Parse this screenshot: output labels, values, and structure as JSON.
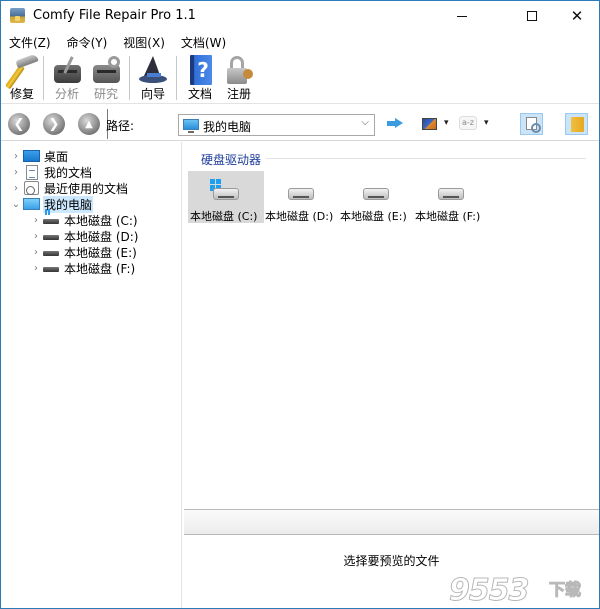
{
  "window": {
    "title": "Comfy File Repair Pro 1.1",
    "minimize": "minimize",
    "maximize": "maximize",
    "close": "✕"
  },
  "menu": [
    "文件(Z)",
    "命令(Y)",
    "视图(X)",
    "文档(W)"
  ],
  "toolbar": {
    "repair": "修复",
    "analyze": "分析",
    "research": "研究",
    "wizard": "向导",
    "docs": "文档",
    "register": "注册",
    "docs_glyph": "?"
  },
  "navbar": {
    "back_glyph": "❮",
    "forward_glyph": "❯",
    "up_glyph": "▲",
    "path_label": "路径:",
    "path_value": "我的电脑",
    "combo_arrow": "⌵",
    "dropdown_arrow": "▾",
    "sort_text": "a-z"
  },
  "tree": {
    "items": [
      {
        "label": "桌面",
        "expander": "›",
        "icon": "desktop-icon"
      },
      {
        "label": "我的文档",
        "expander": "›",
        "icon": "document-icon"
      },
      {
        "label": "最近使用的文档",
        "expander": "›",
        "icon": "recent-icon"
      },
      {
        "label": "我的电脑",
        "expander": "⌄",
        "icon": "computer-icon",
        "selected": true
      },
      {
        "label": "本地磁盘 (C:)",
        "expander": "›",
        "icon": "drive-icon"
      },
      {
        "label": "本地磁盘 (D:)",
        "expander": "›",
        "icon": "drive-icon"
      },
      {
        "label": "本地磁盘 (E:)",
        "expander": "›",
        "icon": "drive-icon"
      },
      {
        "label": "本地磁盘 (F:)",
        "expander": "›",
        "icon": "drive-icon"
      }
    ]
  },
  "content": {
    "group_title": "硬盘驱动器",
    "drives": [
      {
        "label": "本地磁盘 (C:)",
        "selected": true
      },
      {
        "label": "本地磁盘 (D:)"
      },
      {
        "label": "本地磁盘 (E:)"
      },
      {
        "label": "本地磁盘 (F:)"
      }
    ]
  },
  "preview": {
    "placeholder": "选择要预览的文件"
  },
  "watermark": {
    "text": "9553",
    "sub": "下载"
  }
}
